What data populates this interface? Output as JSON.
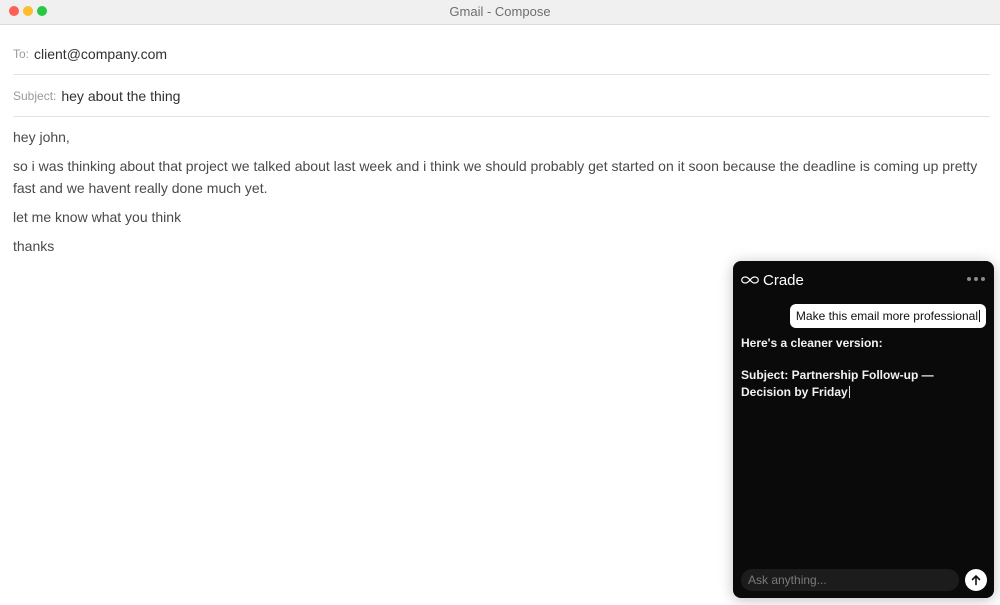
{
  "window": {
    "title": "Gmail - Compose"
  },
  "compose": {
    "to_label": "To:",
    "to_value": "client@company.com",
    "subject_label": "Subject:",
    "subject_value": "hey about the thing",
    "body": [
      "hey john,",
      "so i was thinking about that project we talked about last week and i think we should probably get started on it soon because the deadline is coming up pretty fast and we havent really done much yet.",
      "let me know what you think",
      "thanks"
    ]
  },
  "assistant_panel": {
    "name": "Crade",
    "logo_icon": "infinity-icon",
    "menu_icon": "more-dots-icon",
    "user_message": "Make this email more professional",
    "response_intro": "Here's a cleaner version:",
    "response_subject": "Subject: Partnership Follow-up — Decision by Friday",
    "input_placeholder": "Ask anything...",
    "send_icon": "arrow-up-icon"
  },
  "colors": {
    "panel_bg": "#0a0a0a",
    "titlebar_bg": "#f0f0f0",
    "traffic_red": "#fe5f57",
    "traffic_yellow": "#febc2e",
    "traffic_green": "#28c840"
  }
}
